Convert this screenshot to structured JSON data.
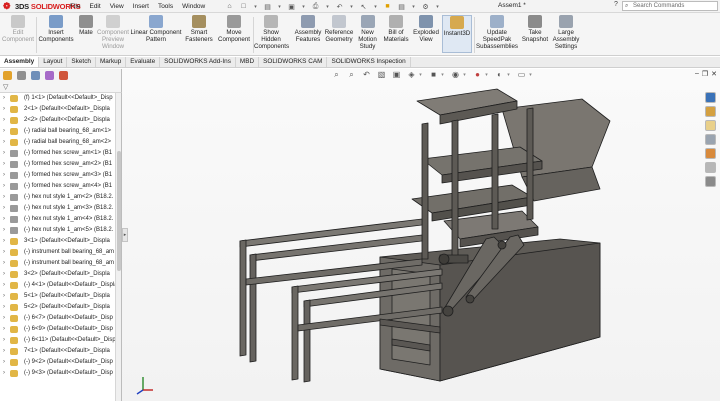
{
  "app": {
    "brand_prefix": "3DS",
    "brand_name": "SOLIDWORKS",
    "document_title": "Assem1 *"
  },
  "menu": [
    "File",
    "Edit",
    "View",
    "Insert",
    "Tools",
    "Window"
  ],
  "search": {
    "placeholder": "Search Commands"
  },
  "ribbon": {
    "edit_component": [
      "Edit",
      "Component"
    ],
    "insert_components": [
      "Insert",
      "Components"
    ],
    "mate": [
      "Mate"
    ],
    "component_preview": [
      "Component",
      "Preview",
      "Window"
    ],
    "linear_pattern": [
      "Linear Component",
      "Pattern"
    ],
    "smart_fasteners": [
      "Smart",
      "Fasteners"
    ],
    "move_component": [
      "Move",
      "Component"
    ],
    "show_hidden": [
      "Show",
      "Hidden",
      "Components"
    ],
    "assembly_features": [
      "Assembly",
      "Features"
    ],
    "reference_geometry": [
      "Reference",
      "Geometry"
    ],
    "new_motion_study": [
      "New",
      "Motion",
      "Study"
    ],
    "bill_of_materials": [
      "Bill of",
      "Materials"
    ],
    "exploded_view": [
      "Exploded",
      "View"
    ],
    "instant3d": [
      "Instant3D"
    ],
    "update_speedpak": [
      "Update",
      "SpeedPak",
      "Subassemblies"
    ],
    "take_snapshot": [
      "Take",
      "Snapshot"
    ],
    "large_assembly": [
      "Large",
      "Assembly",
      "Settings"
    ]
  },
  "tabs": [
    "Assembly",
    "Layout",
    "Sketch",
    "Markup",
    "Evaluate",
    "SOLIDWORKS Add-Ins",
    "MBD",
    "SOLIDWORKS CAM",
    "SOLIDWORKS Inspection"
  ],
  "active_tab": "Assembly",
  "tree": [
    {
      "label": "(f) 1<1> (Default<<Default>_Disp",
      "icon": "part"
    },
    {
      "label": "2<1> (Default<<Default>_Displa",
      "icon": "part"
    },
    {
      "label": "2<2> (Default<<Default>_Displa",
      "icon": "part"
    },
    {
      "label": "(-) radial ball bearing_68_am<1>",
      "icon": "part"
    },
    {
      "label": "(-) radial ball bearing_68_am<2>",
      "icon": "part"
    },
    {
      "label": "(-) formed hex screw_am<1> (B1",
      "icon": "screw"
    },
    {
      "label": "(-) formed hex screw_am<2> (B1",
      "icon": "screw"
    },
    {
      "label": "(-) formed hex screw_am<3> (B1",
      "icon": "screw"
    },
    {
      "label": "(-) formed hex screw_am<4> (B1",
      "icon": "screw"
    },
    {
      "label": "(-) hex nut style 1_am<2> (B18.2.",
      "icon": "screw"
    },
    {
      "label": "(-) hex nut style 1_am<3> (B18.2.",
      "icon": "screw"
    },
    {
      "label": "(-) hex nut style 1_am<4> (B18.2.",
      "icon": "screw"
    },
    {
      "label": "(-) hex nut style 1_am<5> (B18.2.",
      "icon": "screw"
    },
    {
      "label": "3<1> (Default<<Default>_Displa",
      "icon": "part"
    },
    {
      "label": "(-) instrument ball bearing_68_am",
      "icon": "part"
    },
    {
      "label": "(-) instrument ball bearing_68_am",
      "icon": "part"
    },
    {
      "label": "3<2> (Default<<Default>_Displa",
      "icon": "part"
    },
    {
      "label": "(-) 4<1> (Default<<Default>_Displa",
      "icon": "part"
    },
    {
      "label": "5<1> (Default<<Default>_Displa",
      "icon": "part"
    },
    {
      "label": "5<2> (Default<<Default>_Displa",
      "icon": "part"
    },
    {
      "label": "(-) 6<7> (Default<<Default>_Disp",
      "icon": "part"
    },
    {
      "label": "(-) 6<9> (Default<<Default>_Disp",
      "icon": "part"
    },
    {
      "label": "(-) 6<11> (Default<<Default>_Disp",
      "icon": "part"
    },
    {
      "label": "7<1> (Default<<Default>_Displa",
      "icon": "part"
    },
    {
      "label": "(-) 9<2> (Default<<Default>_Disp",
      "icon": "part"
    },
    {
      "label": "(-) 9<3> (Default<<Default>_Disp",
      "icon": "part"
    }
  ],
  "colors": {
    "brand": "#d81e1e",
    "model_body": "#6b6862",
    "model_edge": "#1f1f1f",
    "active_button": "#dfe8f3"
  }
}
